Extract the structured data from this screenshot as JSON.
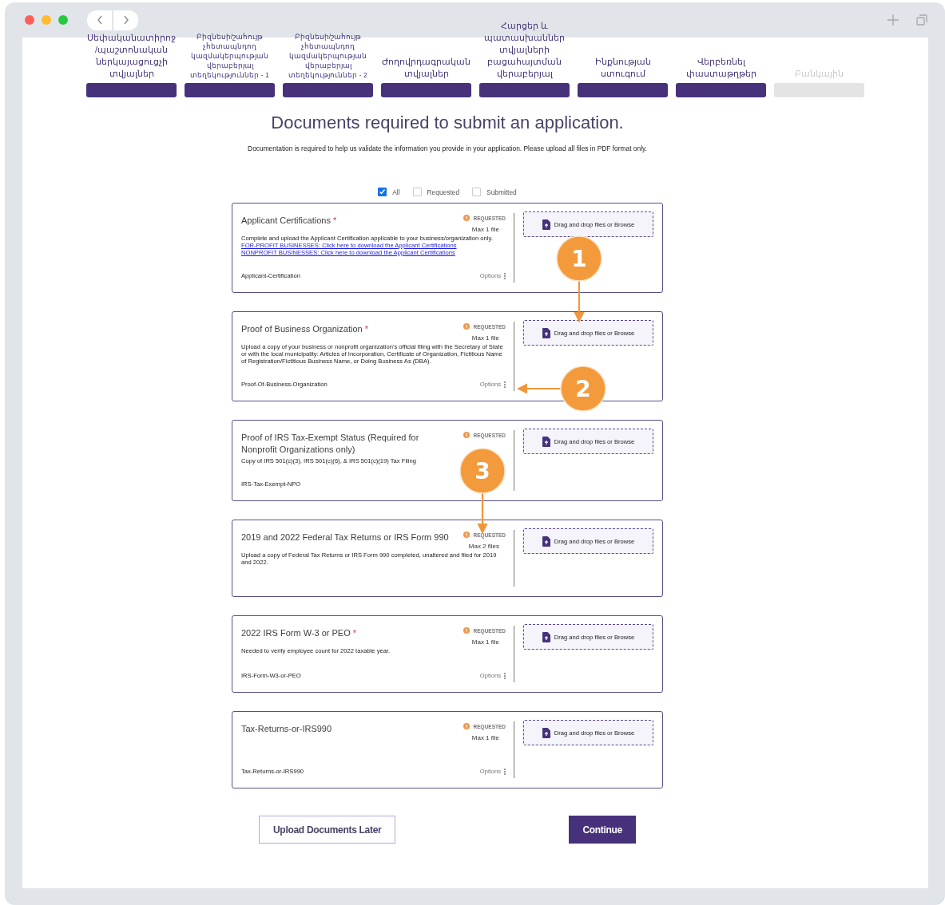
{
  "steps": [
    {
      "label": "Սեփականատիրոջ/պաշտոնական ներկայացուցչի տվյալներ",
      "kind": "regular",
      "done": true
    },
    {
      "label": "Բիզնեսի/շահույթ չհետապնդող կազմակերպության վերաբերյալ տեղեկություններ - 1",
      "kind": "compact",
      "done": true
    },
    {
      "label": "Բիզնեսի/շահույթ չհետապնդող կազմակերպության վերաբերյալ տեղեկություններ - 2",
      "kind": "compact",
      "done": true
    },
    {
      "label": "Ժողովրդագրական տվյալներ",
      "kind": "regular",
      "done": true
    },
    {
      "label": "Հարցեր և պատասխաններ տվյալների բացահայտման վերաբերյալ",
      "kind": "regular",
      "done": true
    },
    {
      "label": "Ինքնության ստուգում",
      "kind": "regular",
      "done": true
    },
    {
      "label": "Վերբեռնել փաստաթղթեր",
      "kind": "regular",
      "done": true
    },
    {
      "label": "Բանկային",
      "kind": "regular",
      "done": false
    }
  ],
  "heading": "Documents required to submit an application.",
  "intro": "Documentation is required to help us validate the information you provide in your application. Please upload all files in PDF format only.",
  "filters": [
    {
      "label": "All",
      "checked": true
    },
    {
      "label": "Requested",
      "checked": false
    },
    {
      "label": "Submitted",
      "checked": false
    }
  ],
  "documents": [
    {
      "title": "Applicant Certifications",
      "required_mark": "*",
      "status": "REQUESTED",
      "max": "Max 1 file",
      "description": "Complete and upload the Applicant Certification applicable to your business/organization only.",
      "links": [
        "FOR-PROFIT BUSINESSES: Click here to download the Applicant Certifications",
        "NONPROFIT BUSINESSES: Click here to download the Applicant Certifications"
      ],
      "file_id": "Applicant-Certification",
      "options": "Options",
      "dropzone": "Drag and drop files or Browse"
    },
    {
      "title": "Proof of Business Organization",
      "required_mark": "*",
      "status": "REQUESTED",
      "max": "Max 1 file",
      "description": "Upload a copy of your business or nonprofit organization's official filing with the Secretary of State or with the local municipality: Articles of Incorporation, Certificate of Organization, Fictitious Name of Registration/Fictitious Business Name, or Doing Business As (DBA).",
      "file_id": "Proof-Of-Business-Organization",
      "options": "Options",
      "dropzone": "Drag and drop files or Browse"
    },
    {
      "title": "Proof of IRS Tax-Exempt Status (Required for Nonprofit Organizations only)",
      "status": "REQUESTED",
      "description": "Copy of IRS 501(c)(3), IRS 501(c)(6), & IRS 501(c)(19) Tax Filing",
      "file_id": "IRS-Tax-Exempt-NPO",
      "dropzone": "Drag and drop files or Browse"
    },
    {
      "title": "2019 and 2022 Federal Tax Returns or IRS Form 990",
      "status": "REQUESTED",
      "max": "Max 2 files",
      "description": "Upload a copy of Federal Tax Returns or IRS Form 990 completed, unaltered and filed for 2019 and 2022.",
      "dropzone": "Drag and drop files or Browse"
    },
    {
      "title": "2022 IRS Form W-3 or PEO",
      "required_mark": "*",
      "status": "REQUESTED",
      "max": "Max 1 file",
      "description": "Needed to verify employee count for 2022 taxable year.",
      "file_id": "IRS-Form-W3-or-PEO",
      "options": "Options",
      "dropzone": "Drag and drop files or Browse"
    },
    {
      "title": "Tax-Returns-or-IRS990",
      "status": "REQUESTED",
      "max": "Max 1 file",
      "file_id": "Tax-Returns-or-IRS990",
      "options": "Options",
      "dropzone": "Drag and drop files or Browse"
    }
  ],
  "actions": [
    {
      "label": "Upload Documents Later",
      "kind": "secondary"
    },
    {
      "label": "Continue",
      "kind": "primary"
    }
  ],
  "callouts": [
    {
      "number": "1"
    },
    {
      "number": "2"
    },
    {
      "number": "3"
    }
  ]
}
